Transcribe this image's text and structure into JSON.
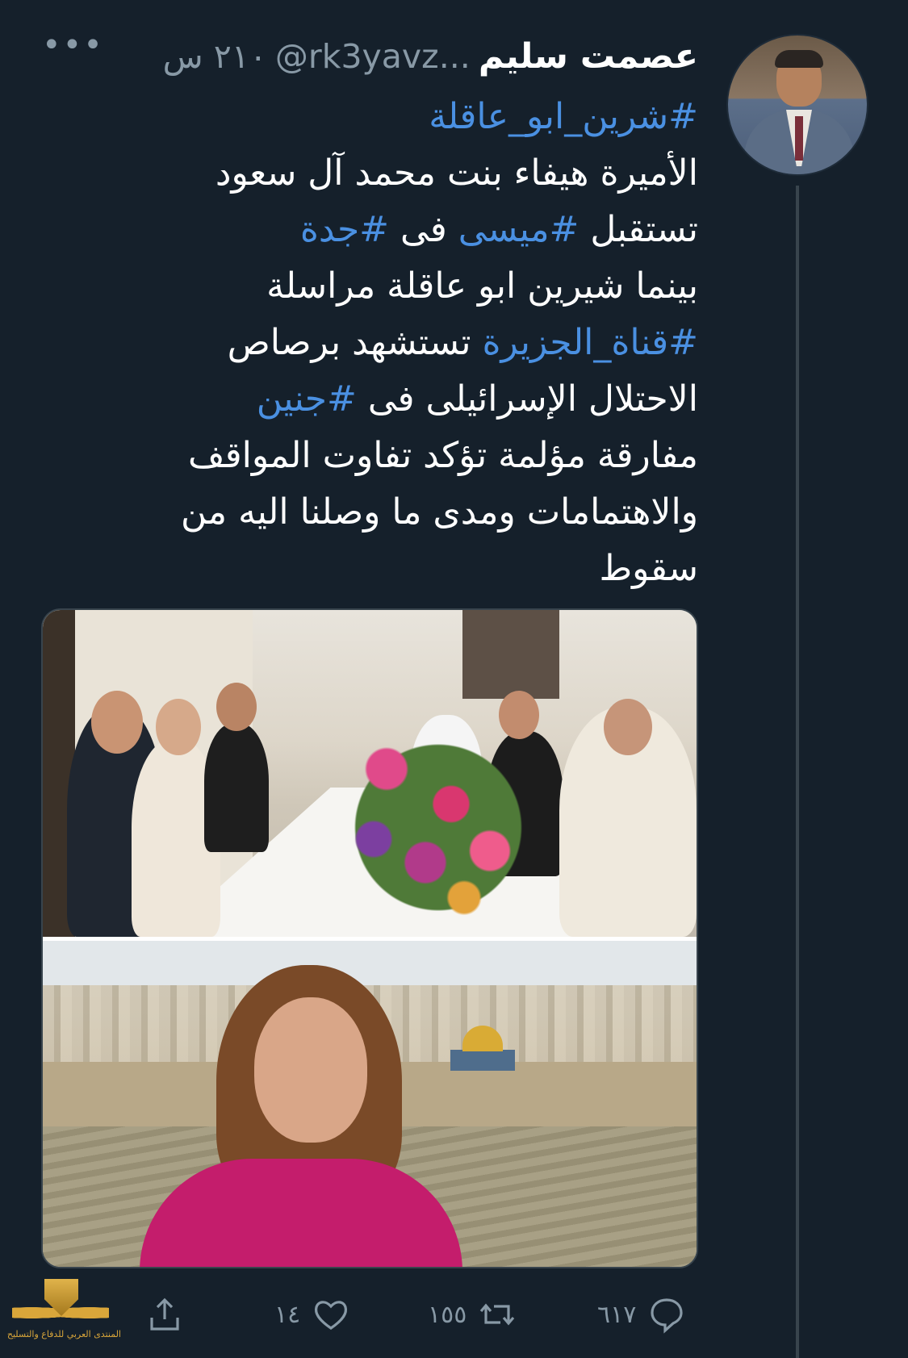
{
  "tweet": {
    "author_name": "عصمت سليم",
    "handle": "@rk3yavz...",
    "time": "٢١٠ س",
    "text_lines": [
      [
        {
          "t": "#شرين_ابو_عاقلة",
          "tag": true
        }
      ],
      [
        {
          "t": "الأميرة هيفاء بنت محمد آل سعود",
          "tag": false
        }
      ],
      [
        {
          "t": "تستقبل ",
          "tag": false
        },
        {
          "t": "#ميسى",
          "tag": true
        },
        {
          "t": " فى ",
          "tag": false
        },
        {
          "t": "#جدة",
          "tag": true
        }
      ],
      [
        {
          "t": "بينما شيرين ابو عاقلة مراسلة",
          "tag": false
        }
      ],
      [
        {
          "t": "#قناة_الجزيرة",
          "tag": true
        },
        {
          "t": " تستشهد برصاص",
          "tag": false
        }
      ],
      [
        {
          "t": "الاحتلال الإسرائيلى فى ",
          "tag": false
        },
        {
          "t": "#جنين",
          "tag": true
        }
      ],
      [
        {
          "t": "مفارقة مؤلمة تؤكد تفاوت المواقف",
          "tag": false
        }
      ],
      [
        {
          "t": "والاهتمامات ومدى ما وصلنا اليه من",
          "tag": false
        }
      ],
      [
        {
          "t": "سقوط",
          "tag": false
        }
      ]
    ]
  },
  "actions": {
    "reply_count": "٦١٧",
    "retweet_count": "١٥٥",
    "like_count": "١٤"
  },
  "watermark": {
    "text": "المنتدى العربي للدفاع والتسليح"
  },
  "icons": {
    "more": "more-icon",
    "reply": "reply-icon",
    "retweet": "retweet-icon",
    "like": "heart-icon",
    "share": "share-icon"
  },
  "colors": {
    "background": "#15202b",
    "hashtag": "#4a90e2",
    "secondary_text": "#8899a6"
  }
}
